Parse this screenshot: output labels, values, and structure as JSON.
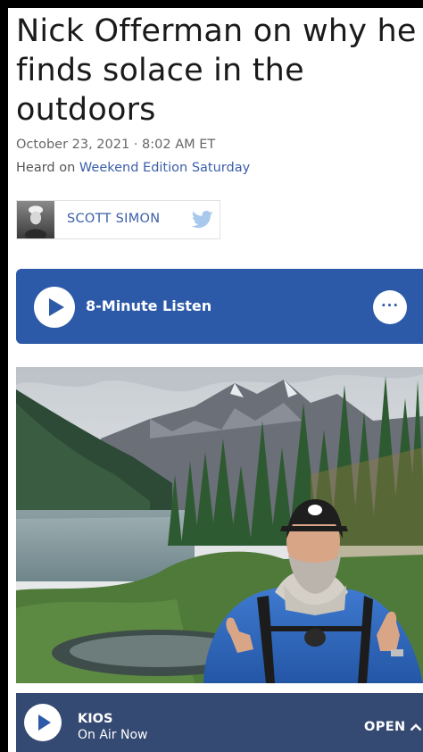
{
  "article": {
    "title": "Nick Offerman on why he finds solace in the outdoors",
    "dateline": "October 23, 2021 · 8:02 AM ET",
    "heard_prefix": "Heard on ",
    "program": "Weekend Edition Saturday"
  },
  "byline": {
    "author": "SCOTT SIMON",
    "social_icon": "twitter-icon"
  },
  "player": {
    "listen_label": "8-Minute Listen",
    "more_label": "···"
  },
  "photo": {
    "subject_icon": "landscape-photo"
  },
  "now_playing": {
    "station": "KIOS",
    "status": "On Air Now",
    "open_label": "OPEN"
  },
  "colors": {
    "brand_blue": "#2c5aa9",
    "link_blue": "#3b5fa8",
    "bar_navy": "#354a72",
    "twitter_blue": "#a9c9ec"
  }
}
